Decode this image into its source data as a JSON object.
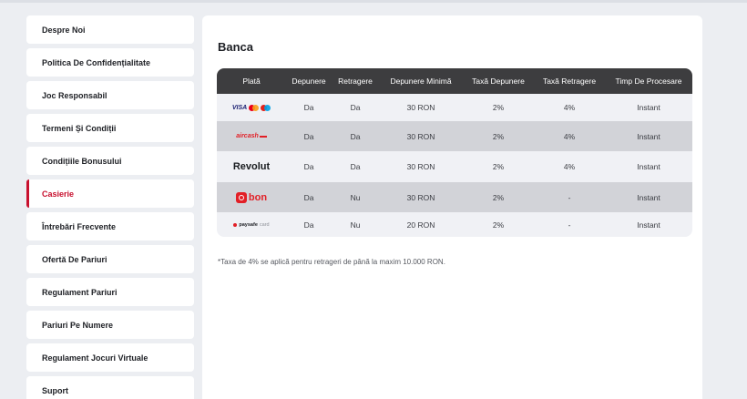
{
  "sidebar": {
    "items": [
      {
        "label": "Despre Noi",
        "active": false
      },
      {
        "label": "Politica De Confidențialitate",
        "active": false
      },
      {
        "label": "Joc Responsabil",
        "active": false
      },
      {
        "label": "Termeni Și Condiții",
        "active": false
      },
      {
        "label": "Condițiile Bonusului",
        "active": false
      },
      {
        "label": "Casierie",
        "active": true
      },
      {
        "label": "Întrebări Frecvente",
        "active": false
      },
      {
        "label": "Ofertă De Pariuri",
        "active": false
      },
      {
        "label": "Regulament Pariuri",
        "active": false
      },
      {
        "label": "Pariuri Pe Numere",
        "active": false
      },
      {
        "label": "Regulament Jocuri Virtuale",
        "active": false
      },
      {
        "label": "Suport",
        "active": false
      }
    ]
  },
  "main": {
    "title": "Banca",
    "table": {
      "headers": [
        "Plată",
        "Depunere",
        "Retragere",
        "Depunere Minimă",
        "Taxă Depunere",
        "Taxă Retragere",
        "Timp De Procesare"
      ],
      "rows": [
        {
          "method": "visa-mastercard-maestro",
          "deposit": "Da",
          "withdraw": "Da",
          "min_deposit": "30 RON",
          "deposit_fee": "2%",
          "withdraw_fee": "4%",
          "processing": "Instant"
        },
        {
          "method": "aircash",
          "deposit": "Da",
          "withdraw": "Da",
          "min_deposit": "30 RON",
          "deposit_fee": "2%",
          "withdraw_fee": "4%",
          "processing": "Instant"
        },
        {
          "method": "revolut",
          "deposit": "Da",
          "withdraw": "Da",
          "min_deposit": "30 RON",
          "deposit_fee": "2%",
          "withdraw_fee": "4%",
          "processing": "Instant"
        },
        {
          "method": "abon",
          "deposit": "Da",
          "withdraw": "Nu",
          "min_deposit": "30 RON",
          "deposit_fee": "2%",
          "withdraw_fee": "-",
          "processing": "Instant"
        },
        {
          "method": "paysafecard",
          "deposit": "Da",
          "withdraw": "Nu",
          "min_deposit": "20 RON",
          "deposit_fee": "2%",
          "withdraw_fee": "-",
          "processing": "Instant"
        }
      ]
    },
    "logos": {
      "visa": "VISA",
      "aircash": "aircash",
      "revolut": "Revolut",
      "abon": "bon",
      "paysafe": "paysafe",
      "paysafe_card": "card"
    },
    "footnote": "*Taxa de 4% se aplică pentru retrageri de până la maxim 10.000 RON."
  },
  "colors": {
    "accent": "#c8102e",
    "table_header": "#3d3d3f",
    "row_light": "#f0f1f5",
    "row_dark": "#d2d3d8",
    "background": "#eceef2"
  }
}
